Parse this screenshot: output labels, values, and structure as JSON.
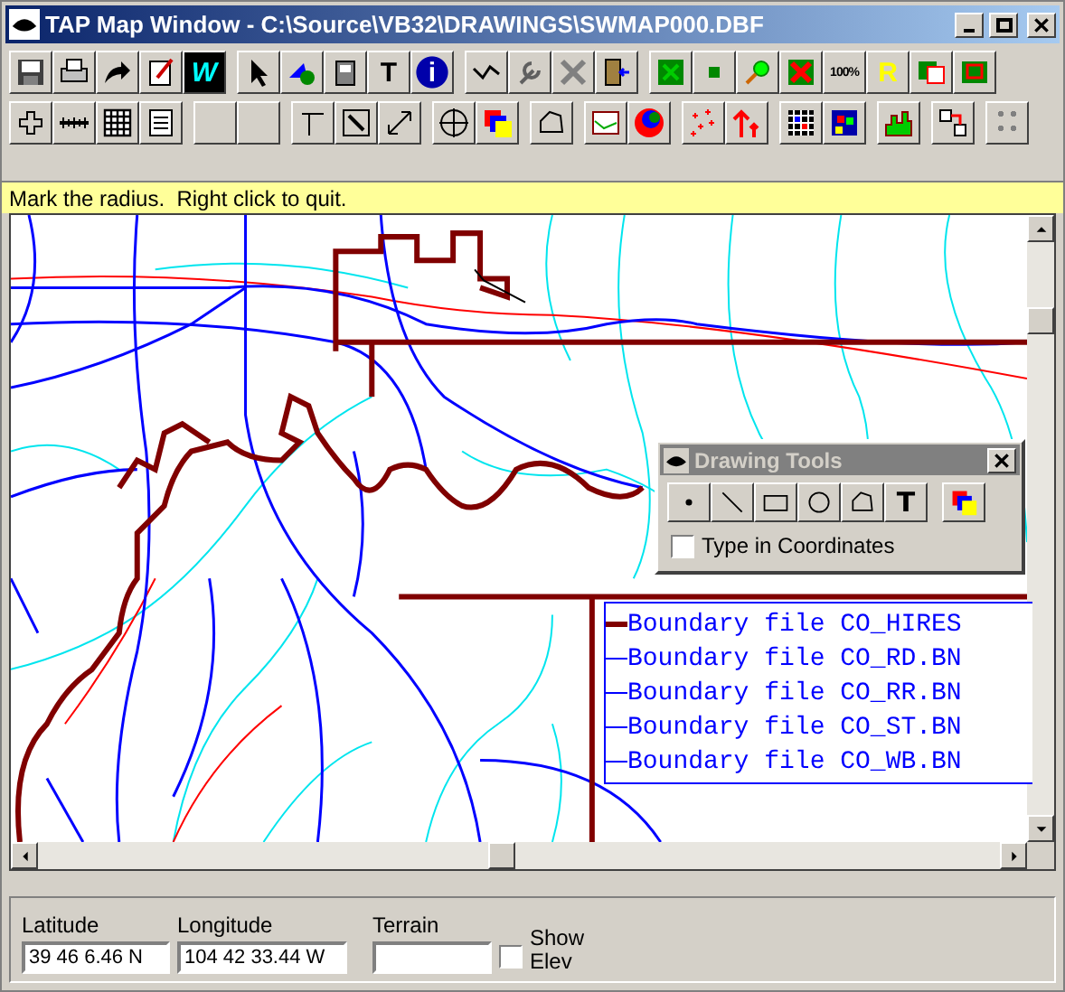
{
  "window": {
    "title": "TAP Map Window - C:\\Source\\VB32\\DRAWINGS\\SWMAP000.DBF"
  },
  "toolbar_rows": [
    [
      [
        {
          "kind": "icon"
        },
        {
          "kind": "icon"
        },
        {
          "kind": "icon"
        },
        {
          "kind": "icon"
        },
        {
          "kind": "text",
          "label": "W"
        }
      ],
      [
        {
          "kind": "icon"
        },
        {
          "kind": "icon"
        },
        {
          "kind": "icon"
        },
        {
          "kind": "text",
          "label": "T"
        },
        {
          "kind": "text",
          "label": "i"
        }
      ],
      [
        {
          "kind": "icon"
        },
        {
          "kind": "icon"
        },
        {
          "kind": "icon"
        },
        {
          "kind": "icon"
        }
      ],
      [
        {
          "kind": "icon"
        },
        {
          "kind": "icon"
        },
        {
          "kind": "icon"
        },
        {
          "kind": "icon"
        },
        {
          "kind": "text",
          "label": "100%"
        },
        {
          "kind": "text",
          "label": "R"
        },
        {
          "kind": "icon"
        },
        {
          "kind": "icon"
        }
      ]
    ],
    [
      [
        {
          "kind": "icon"
        },
        {
          "kind": "icon"
        },
        {
          "kind": "icon"
        },
        {
          "kind": "icon"
        }
      ],
      [
        {
          "kind": "blank"
        },
        {
          "kind": "blank"
        }
      ],
      [
        {
          "kind": "icon"
        },
        {
          "kind": "icon"
        },
        {
          "kind": "icon"
        }
      ],
      [
        {
          "kind": "icon"
        },
        {
          "kind": "icon"
        }
      ],
      [
        {
          "kind": "icon"
        }
      ],
      [
        {
          "kind": "icon"
        },
        {
          "kind": "icon"
        }
      ],
      [
        {
          "kind": "icon"
        },
        {
          "kind": "icon"
        }
      ],
      [
        {
          "kind": "icon"
        },
        {
          "kind": "icon"
        }
      ],
      [
        {
          "kind": "icon"
        }
      ],
      [
        {
          "kind": "icon"
        }
      ],
      [
        {
          "kind": "icon"
        }
      ]
    ]
  ],
  "status": "Mark the radius.  Right click to quit.",
  "drawing_tools": {
    "title": "Drawing Tools",
    "tools": [
      {
        "kind": "icon"
      },
      {
        "kind": "icon"
      },
      {
        "kind": "icon"
      },
      {
        "kind": "icon"
      },
      {
        "kind": "icon"
      },
      {
        "kind": "text",
        "label": "T"
      },
      {
        "kind": "icon"
      }
    ],
    "type_in_coordinates": {
      "label": "Type in Coordinates",
      "checked": false
    }
  },
  "legend": [
    {
      "text": "Boundary file CO_HIRES",
      "color": "#800000"
    },
    {
      "text": "Boundary file CO_RD.BN",
      "color": "#0000ff"
    },
    {
      "text": "Boundary file CO_RR.BN",
      "color": "#0000ff"
    },
    {
      "text": "Boundary file CO_ST.BN",
      "color": "#0000ff"
    },
    {
      "text": "Boundary file CO_WB.BN",
      "color": "#0000ff"
    }
  ],
  "bottom": {
    "latitude": {
      "label": "Latitude",
      "value": "39 46 6.46 N"
    },
    "longitude": {
      "label": "Longitude",
      "value": "104 42 33.44 W"
    },
    "terrain": {
      "label": "Terrain"
    },
    "show_elev": {
      "label": "Show Elev",
      "checked": false
    }
  }
}
